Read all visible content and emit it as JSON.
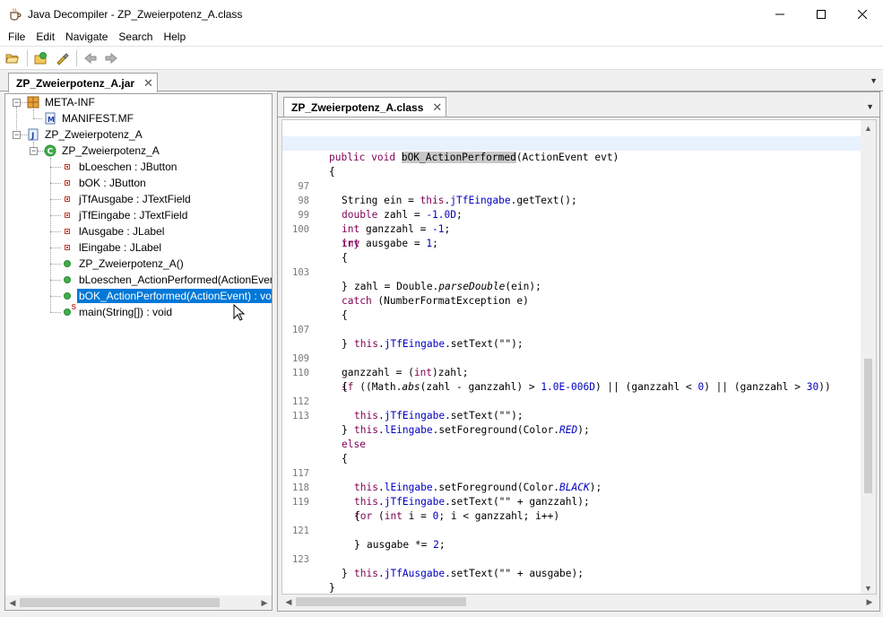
{
  "window": {
    "title": "Java Decompiler - ZP_Zweierpotenz_A.class",
    "app_icon": "coffee-cup-icon",
    "controls": [
      "minimize-icon",
      "maximize-icon",
      "close-icon"
    ]
  },
  "menu": {
    "items": [
      "File",
      "Edit",
      "Navigate",
      "Search",
      "Help"
    ]
  },
  "toolbar": {
    "buttons": [
      "open-file-icon",
      "open-type-icon",
      "find-icon",
      "back-icon",
      "forward-icon"
    ]
  },
  "outer_tab": {
    "label": "ZP_Zweierpotenz_A.jar",
    "close": "✕"
  },
  "tree": {
    "meta_inf": "META-INF",
    "manifest": "MANIFEST.MF",
    "package": "ZP_Zweierpotenz_A",
    "class": "ZP_Zweierpotenz_A",
    "fields": [
      "bLoeschen : JButton",
      "bOK : JButton",
      "jTfAusgabe : JTextField",
      "jTfEingabe : JTextField",
      "lAusgabe : JLabel",
      "lEingabe : JLabel"
    ],
    "methods": [
      "ZP_Zweierpotenz_A()",
      "bLoeschen_ActionPerformed(ActionEvent) : void",
      "bOK_ActionPerformed(ActionEvent) : void",
      "main(String[]) : void"
    ],
    "selected_method_index": 2
  },
  "editor": {
    "tab_label": "ZP_Zweierpotenz_A.class",
    "tab_close": "✕",
    "line_numbers": [
      "97",
      "98",
      "99",
      "100",
      "103",
      "107",
      "109",
      "110",
      "112",
      "113",
      "117",
      "118",
      "119",
      "121",
      "123"
    ],
    "code": {
      "sig_kw": "public void ",
      "sig_name": "bOK_ActionPerformed",
      "sig_rest": "(ActionEvent evt)",
      "open_brace": "{",
      "close_brace": "}",
      "l97_a": "String ein = ",
      "l97_this": "this",
      "l97_dot": ".",
      "l97_field": "jTfEingabe",
      "l97_rest": ".getText();",
      "l98_kw": "double",
      "l98_a": " zahl = ",
      "l98_num": "-1.0D",
      "l98_end": ";",
      "l99_kw": "int",
      "l99_a": " ganzzahl = ",
      "l99_num": "-1",
      "l99_end": ";",
      "l100_kw": "int",
      "l100_a": " ausgabe = ",
      "l100_num": "1",
      "l100_end": ";",
      "try_kw": "try",
      "l103_a": "zahl = Double.",
      "l103_m": "parseDouble",
      "l103_rest": "(ein);",
      "catch_kw": "catch",
      "catch_rest": " (NumberFormatException e)",
      "l107_this": "this",
      "l107_dot": ".",
      "l107_field": "jTfEingabe",
      "l107_rest": ".setText(\"\");",
      "l109_a": "ganzzahl = (",
      "l109_kw": "int",
      "l109_rest": ")zahl;",
      "l110_kw": "if",
      "l110_a": " ((Math.",
      "l110_m": "abs",
      "l110_b": "(zahl - ganzzahl) > ",
      "l110_n1": "1.0E-006D",
      "l110_c": ") || (ganzzahl < ",
      "l110_n2": "0",
      "l110_d": ") || (ganzzahl > ",
      "l110_n3": "30",
      "l110_e": "))",
      "l112_this": "this",
      "l112_dot": ".",
      "l112_field": "jTfEingabe",
      "l112_rest": ".setText(\"\");",
      "l113_this": "this",
      "l113_dot": ".",
      "l113_field": "lEingabe",
      "l113_a": ".setForeground(Color.",
      "l113_const": "RED",
      "l113_end": ");",
      "else_kw": "else",
      "l117_this": "this",
      "l117_dot": ".",
      "l117_field": "lEingabe",
      "l117_a": ".setForeground(Color.",
      "l117_const": "BLACK",
      "l117_end": ");",
      "l118_this": "this",
      "l118_dot": ".",
      "l118_field": "jTfEingabe",
      "l118_rest": ".setText(\"\" + ganzzahl);",
      "for_kw": "for",
      "l119_a": " (",
      "l119_kw": "int",
      "l119_b": " i = ",
      "l119_n": "0",
      "l119_rest": "; i < ganzzahl; i++)",
      "l121_a": "ausgabe *= ",
      "l121_n": "2",
      "l121_end": ";",
      "l123_this": "this",
      "l123_dot": ".",
      "l123_field": "jTfAusgabe",
      "l123_rest": ".setText(\"\" + ausgabe);"
    }
  },
  "scroll": {
    "tree_h_fraction": 0.84,
    "editor_h_fraction": 0.3,
    "editor_v_position": 0.72
  },
  "colors": {
    "selection": "#0078d7",
    "keyword": "#7f0055",
    "field": "#0000c0",
    "current_line": "#e8f2fe"
  }
}
